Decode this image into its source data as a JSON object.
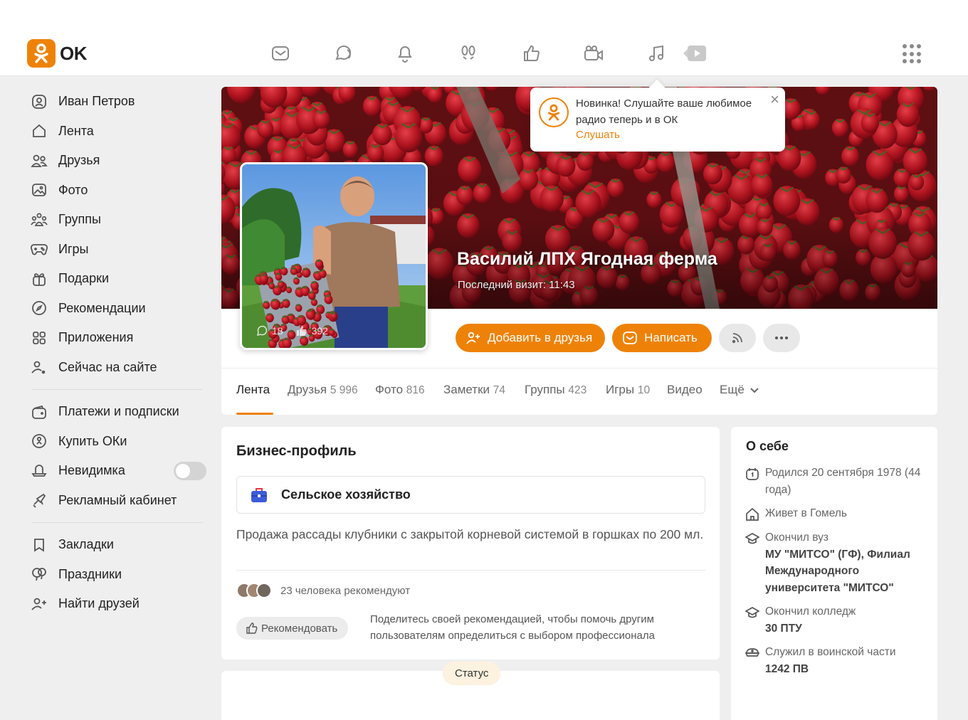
{
  "header": {
    "logo_text": "OK",
    "nav_icons": [
      "messages-icon",
      "discussions-icon",
      "notifications-icon",
      "guests-icon",
      "events-icon",
      "video-calls-icon",
      "music-icon",
      "video-icon"
    ],
    "accent_color": "#ee8208"
  },
  "sidebar": {
    "user_name": "Иван Петров",
    "items": [
      "Лента",
      "Друзья",
      "Фото",
      "Группы",
      "Игры",
      "Подарки",
      "Рекомендации",
      "Приложения",
      "Сейчас на сайте"
    ],
    "items2": [
      "Платежи и подписки",
      "Купить ОКи",
      "Невидимка",
      "Рекламный кабинет"
    ],
    "items3": [
      "Закладки",
      "Праздники",
      "Найти друзей"
    ],
    "invisible_mode": false
  },
  "profile": {
    "name": "Василий ЛПХ Ягодная ферма",
    "last_visit": "Последний визит: 11:43",
    "avatar_comments": "18",
    "avatar_likes": "392",
    "add_friend_label": "Добавить в друзья",
    "message_label": "Написать"
  },
  "tabs": [
    {
      "label": "Лента",
      "count": ""
    },
    {
      "label": "Друзья",
      "count": "5 996"
    },
    {
      "label": "Фото",
      "count": "816"
    },
    {
      "label": "Заметки",
      "count": "74"
    },
    {
      "label": "Группы",
      "count": "423"
    },
    {
      "label": "Игры",
      "count": "10"
    },
    {
      "label": "Видео",
      "count": ""
    },
    {
      "label": "Ещё",
      "count": ""
    }
  ],
  "popup": {
    "text": "Новинка! Слушайте ваше любимое радио теперь и в ОК",
    "link": "Слушать",
    "close": "×"
  },
  "business": {
    "title": "Бизнес-профиль",
    "category": "Сельское хозяйство",
    "description": "Продажа рассады клубники с закрытой корневой системой в горшках по 200 мл.",
    "recommend_count": "23 человека рекомендуют",
    "recommend_button": "Рекомендовать",
    "recommend_hint": "Поделитесь своей рекомендацией, чтобы помочь другим пользователям определиться с выбором профессионала"
  },
  "about": {
    "title": "О себе",
    "born": "Родился 20 сентября 1978 (44 года)",
    "lives": "Живет в Гомель",
    "university_label": "Окончил вуз",
    "university": "МУ \"МИТСО\" (ГФ), Филиал Международного университета \"МИТСО\"",
    "college_label": "Окончил колледж",
    "college": "30 ПТУ",
    "army_label": "Служил в воинской части",
    "army": "1242 ПВ"
  },
  "status": {
    "label": "Статус"
  }
}
